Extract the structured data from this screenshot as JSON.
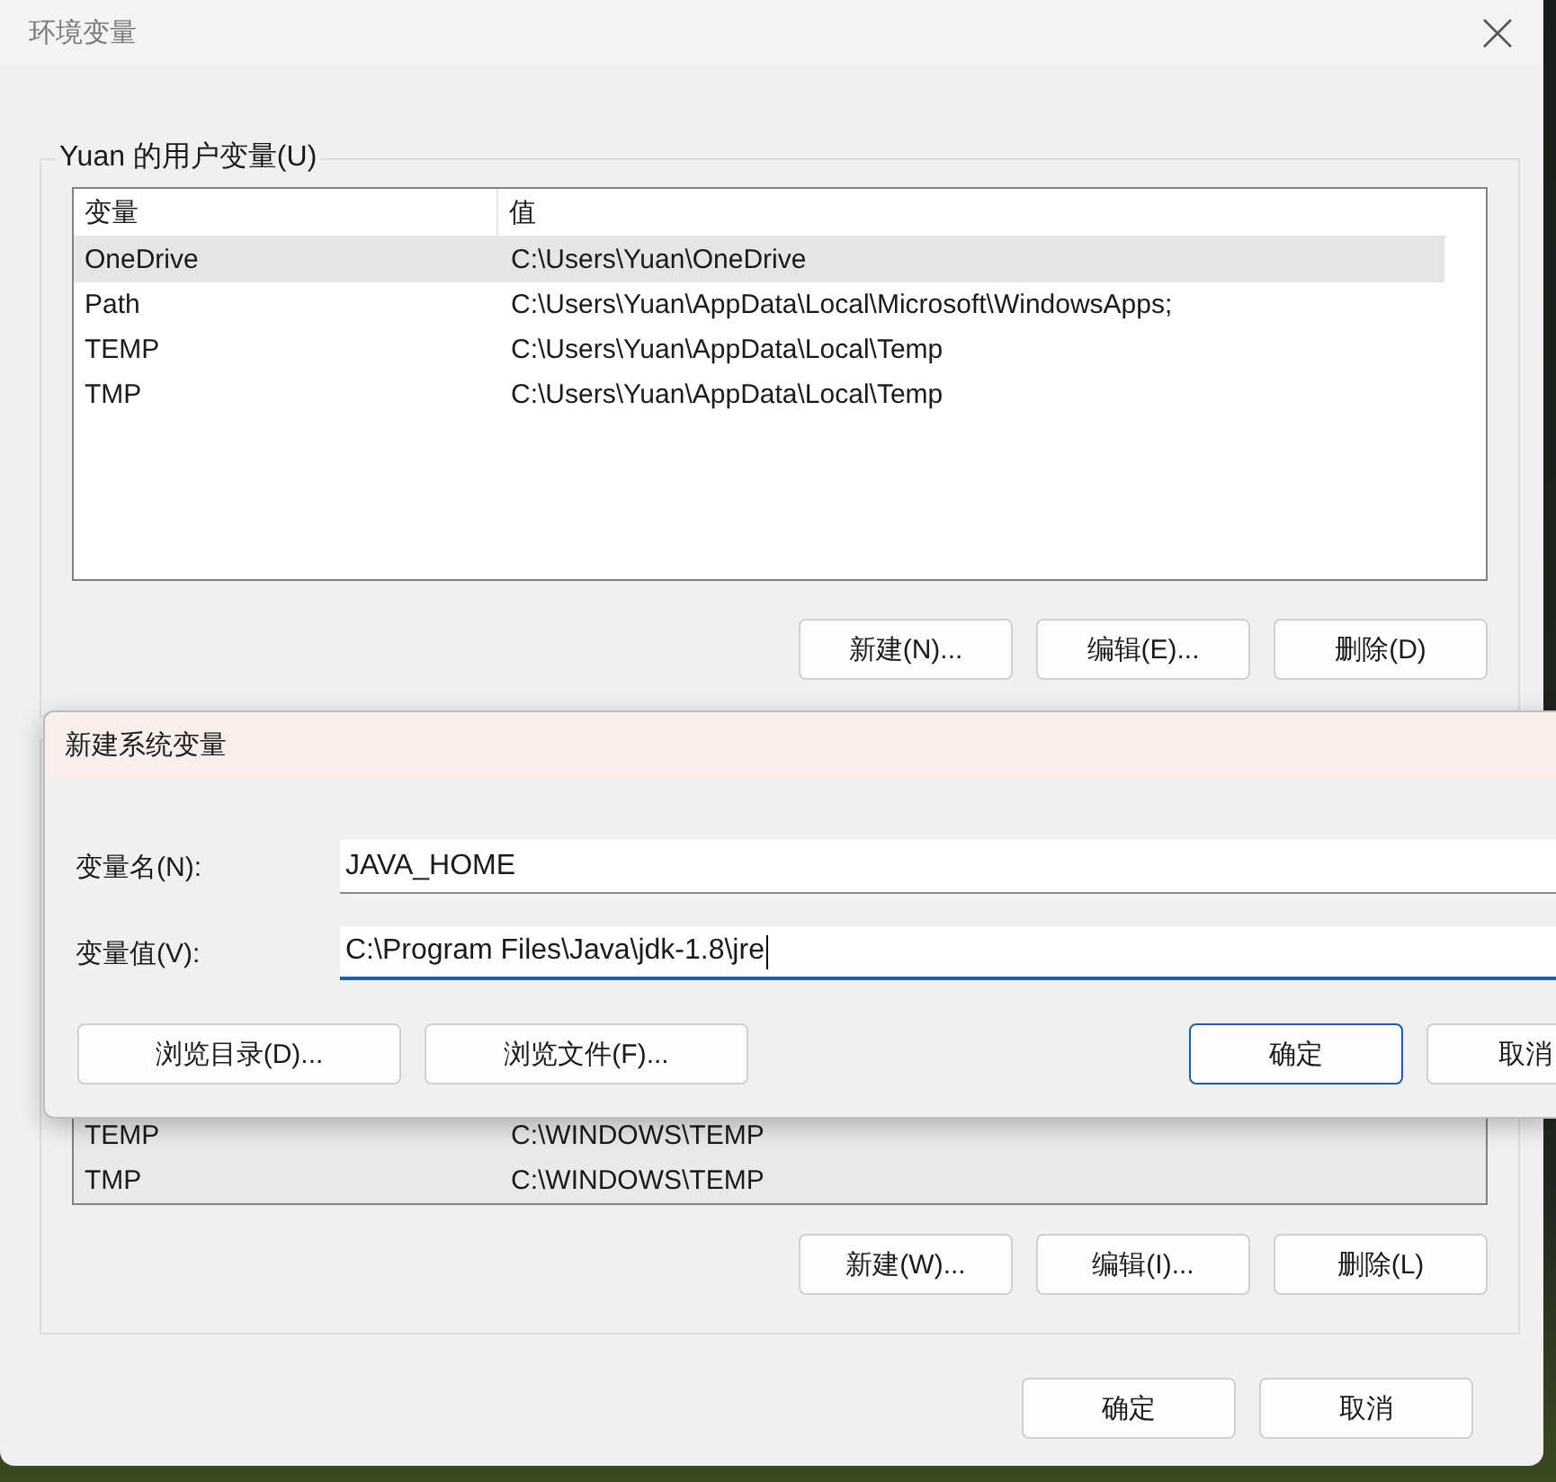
{
  "window": {
    "title": "环境变量"
  },
  "user_vars": {
    "label": "Yuan 的用户变量(U)",
    "columns": [
      "变量",
      "值"
    ],
    "rows": [
      {
        "name": "OneDrive",
        "value": "C:\\Users\\Yuan\\OneDrive",
        "selected": true
      },
      {
        "name": "Path",
        "value": "C:\\Users\\Yuan\\AppData\\Local\\Microsoft\\WindowsApps;",
        "selected": false
      },
      {
        "name": "TEMP",
        "value": "C:\\Users\\Yuan\\AppData\\Local\\Temp",
        "selected": false
      },
      {
        "name": "TMP",
        "value": "C:\\Users\\Yuan\\AppData\\Local\\Temp",
        "selected": false
      }
    ],
    "buttons": [
      "新建(N)...",
      "编辑(E)...",
      "删除(D)"
    ]
  },
  "system_vars": {
    "rows": [
      {
        "name": "TEMP",
        "value": "C:\\WINDOWS\\TEMP",
        "selected": false
      },
      {
        "name": "TMP",
        "value": "C:\\WINDOWS\\TEMP",
        "selected": false
      }
    ],
    "buttons": [
      "新建(W)...",
      "编辑(I)...",
      "删除(L)"
    ]
  },
  "buttons": [
    "确定",
    "取消"
  ],
  "dialog": {
    "title": "新建系统变量",
    "fields": [
      {
        "label": "变量名(N):",
        "value": "JAVA_HOME",
        "focused": false
      },
      {
        "label": "变量值(V):",
        "value": "C:\\Program Files\\Java\\jdk-1.8\\jre",
        "focused": true
      }
    ],
    "left_buttons": [
      "浏览目录(D)...",
      "浏览文件(F)..."
    ],
    "right_buttons": [
      {
        "label": "确定",
        "default": true
      },
      {
        "label": "取消",
        "default": false
      }
    ]
  }
}
